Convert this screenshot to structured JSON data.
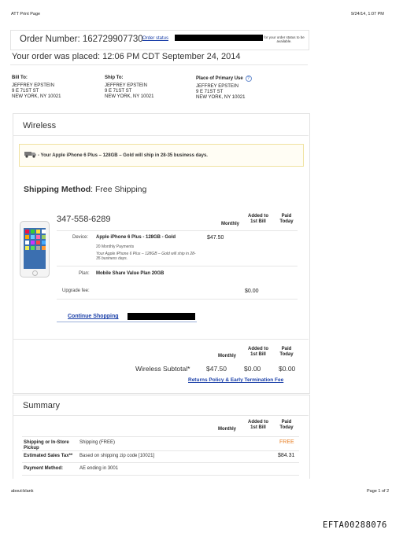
{
  "print_header": {
    "title": "ATT Print Page",
    "datetime": "9/24/14, 1:07 PM"
  },
  "order": {
    "number_label": "Order Number: 162729907730",
    "status_link": "Order status",
    "status_note": "for your order status to be available.",
    "placed_label": "Your order was placed: 12:06 PM CDT September 24, 2014"
  },
  "addresses": {
    "bill_to": {
      "heading": "Bill To:",
      "lines": [
        "JEFFREY EPSTEIN",
        "9 E 71ST ST",
        "NEW YORK, NY 10021"
      ]
    },
    "ship_to": {
      "heading": "Ship To:",
      "lines": [
        "JEFFREY EPSTEIN",
        "9 E 71ST ST",
        "NEW YORK, NY 10021"
      ]
    },
    "primary_use": {
      "heading": "Place of Primary Use",
      "lines": [
        "JEFFREY EPSTEIN",
        "9 E 71ST ST",
        "NEW YORK, NY 10021"
      ]
    }
  },
  "wireless": {
    "section_title": "Wireless",
    "ship_notice": "- Your Apple iPhone 6 Plus – 128GB – Gold will ship in 28-35 business days.",
    "shipping_method_label": "Shipping Method",
    "shipping_method_value": ": Free Shipping",
    "phone_number": "347-558-6289",
    "col_monthly": "Monthly",
    "col_added": "Added to 1st Bill",
    "col_paid": "Paid Today",
    "device_label": "Device:",
    "device_name": "Apple iPhone 6 Plus - 128GB - Gold",
    "device_monthly": "$47.50",
    "device_payments": "20 Monthly Payments",
    "device_note": "Your Apple iPhone 6 Plus – 128GB – Gold will ship in 28-35 business days.",
    "plan_label": "Plan:",
    "plan_name": "Mobile Share Value Plan 20GB",
    "upgrade_label": "Upgrade fee:",
    "upgrade_added": "$0.00",
    "continue_link": "Continue Shopping",
    "subtotal_label": "Wireless Subtotal*",
    "subtotal_monthly": "$47.50",
    "subtotal_added": "$0.00",
    "subtotal_paid": "$0.00",
    "returns_link": "Returns Policy & Early Termination Fee"
  },
  "summary": {
    "section_title": "Summary",
    "col_monthly": "Monthly",
    "col_added": "Added to 1st Bill",
    "col_paid": "Paid Today",
    "rows": [
      {
        "label": "Shipping or In-Store Pickup",
        "desc": "Shipping (FREE)",
        "paid": "FREE"
      },
      {
        "label": "Estimated Sales Tax**",
        "desc": "Based on shipping zip code [10021]",
        "paid": "$84.31"
      },
      {
        "label": "Payment Method:",
        "desc": "AE ending in 3001",
        "paid": ""
      }
    ]
  },
  "print_footer": {
    "url": "about:blank",
    "page": "Page 1 of 2",
    "doc_id": "EFTA00288076"
  },
  "colors": {
    "link": "#1a3fa8",
    "free": "#e8822a",
    "notice_border": "#f0e2a0"
  }
}
